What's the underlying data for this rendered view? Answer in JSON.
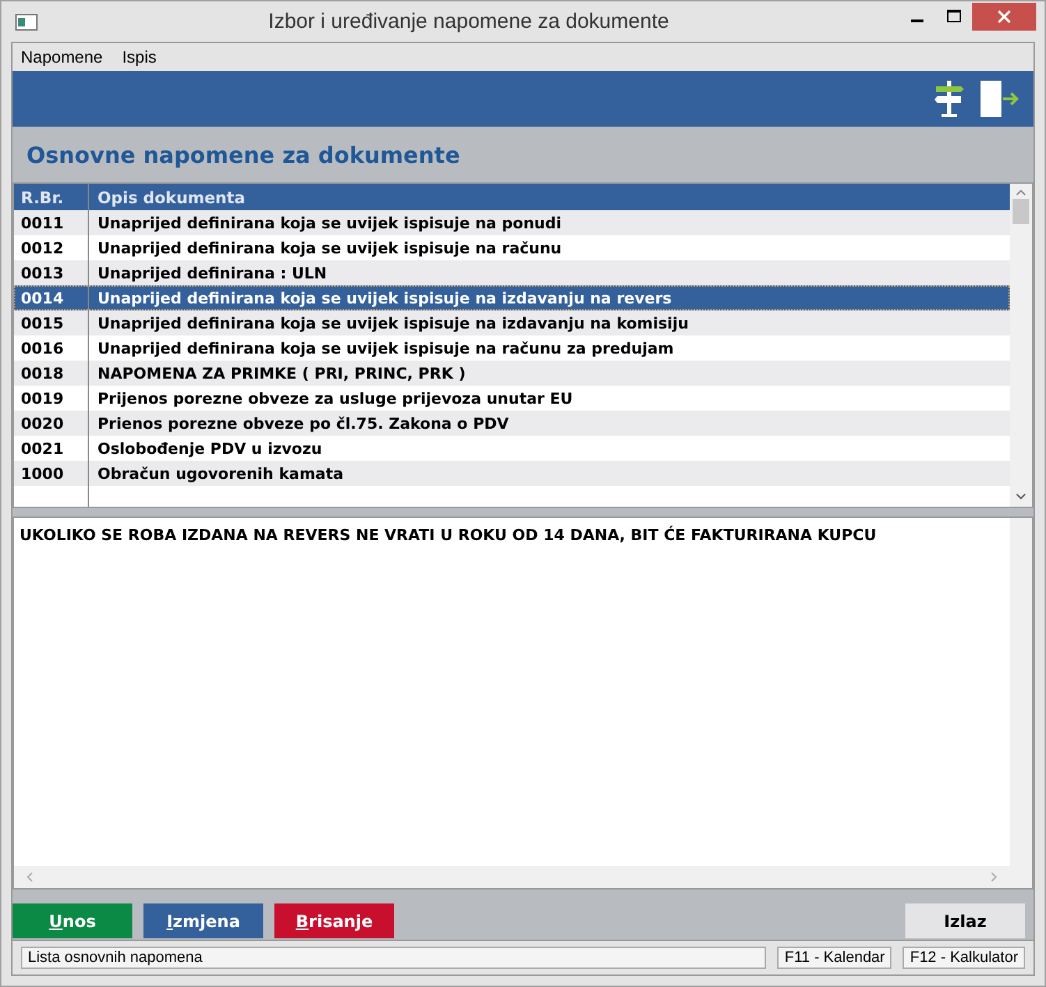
{
  "window": {
    "title": "Izbor i uređivanje napomene za dokumente"
  },
  "menu": [
    "Napomene",
    "Ispis"
  ],
  "header": {
    "title": "Osnovne napomene za dokumente"
  },
  "table": {
    "columns": [
      "R.Br.",
      "Opis dokumenta"
    ],
    "rows": [
      {
        "no": "0011",
        "text": "Unaprijed definirana koja se uvijek ispisuje na ponudi",
        "selected": false
      },
      {
        "no": "0012",
        "text": "Unaprijed definirana koja se uvijek ispisuje na računu",
        "selected": false
      },
      {
        "no": "0013",
        "text": "Unaprijed definirana : ULN",
        "selected": false
      },
      {
        "no": "0014",
        "text": "Unaprijed definirana koja se uvijek ispisuje na izdavanju na revers",
        "selected": true
      },
      {
        "no": "0015",
        "text": "Unaprijed definirana koja se uvijek ispisuje na izdavanju na komisiju",
        "selected": false
      },
      {
        "no": "0016",
        "text": "Unaprijed definirana koja se uvijek ispisuje na računu za predujam",
        "selected": false
      },
      {
        "no": "0018",
        "text": "NAPOMENA ZA PRIMKE ( PRI, PRINC, PRK )",
        "selected": false
      },
      {
        "no": "0019",
        "text": "Prijenos porezne obveze za usluge prijevoza unutar EU",
        "selected": false
      },
      {
        "no": "0020",
        "text": "Prienos porezne obveze po čl.75. Zakona o PDV",
        "selected": false
      },
      {
        "no": "0021",
        "text": "Oslobođenje PDV u izvozu",
        "selected": false
      },
      {
        "no": "1000",
        "text": "Obračun ugovorenih kamata",
        "selected": false
      }
    ]
  },
  "note": {
    "value": "UKOLIKO SE ROBA IZDANA NA REVERS NE VRATI U ROKU OD 14 DANA, BIT ĆE FAKTURIRANA KUPCU"
  },
  "buttons": [
    {
      "label": "Unos",
      "color": "#0b8a45"
    },
    {
      "label": "Izmjena",
      "color": "#34609c"
    },
    {
      "label": "Brisanje",
      "color": "#c8102e"
    }
  ],
  "exit_button": {
    "label": "Izlaz"
  },
  "status_bar": [
    "Lista osnovnih napomena",
    "F11 - Kalendar",
    "F12 - Kalkulator"
  ]
}
